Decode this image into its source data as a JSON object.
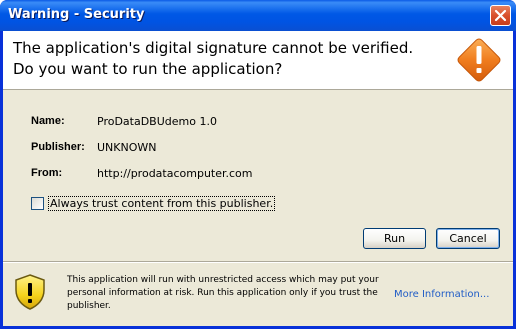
{
  "window": {
    "title": "Warning - Security"
  },
  "header": {
    "line1": "The application's digital signature cannot be verified.",
    "line2": "Do you want to run the application?"
  },
  "details": {
    "name_label": "Name:",
    "name_value": "ProDataDBUdemo 1.0",
    "publisher_label": "Publisher:",
    "publisher_value": "UNKNOWN",
    "from_label": "From:",
    "from_value": "http://prodatacomputer.com"
  },
  "trust": {
    "label": "Always trust content from this publisher.",
    "checked": false
  },
  "buttons": {
    "run": "Run",
    "cancel": "Cancel"
  },
  "footer": {
    "message": "This application will run with unrestricted access which may put your personal information at risk. Run this application only if you trust the publisher.",
    "more_info": "More Information..."
  },
  "icons": {
    "close": "close-icon",
    "header_warning": "warning-diamond-icon",
    "footer_warning": "shield-warning-icon"
  },
  "colors": {
    "titlebar": "#0054e3",
    "client_bg": "#ece9d8",
    "link": "#215dc6",
    "warning_orange": "#f07d1e"
  }
}
